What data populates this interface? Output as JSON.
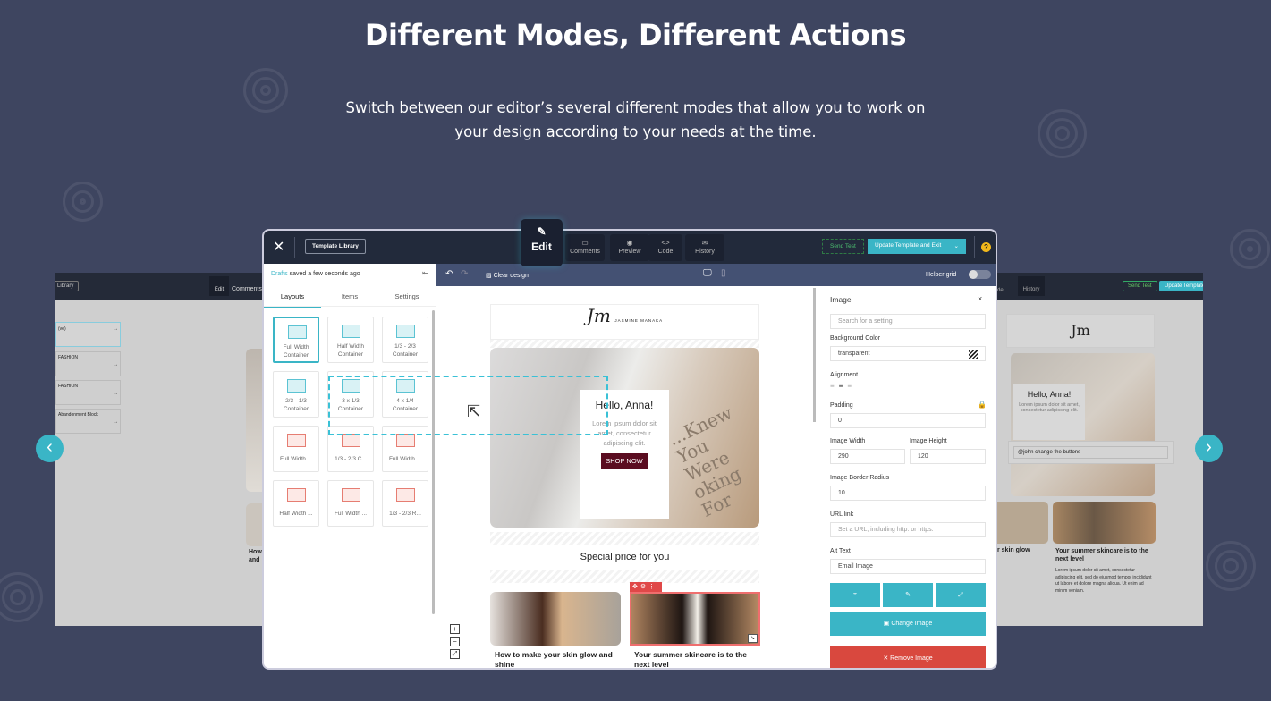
{
  "page": {
    "title": "Different Modes, Different Actions",
    "subtitle_line1": "Switch between our editor’s several different modes that allow you to work on",
    "subtitle_line2": "your design according to your needs at the time."
  },
  "colors": {
    "background": "#3e4560",
    "accent": "#3ab5c6",
    "danger": "#d9483e",
    "send_test": "#3db36a"
  },
  "carousel": {
    "prev_icon": "chevron-left-icon",
    "next_icon": "chevron-right-icon"
  },
  "ghost_left": {
    "library_label": "Library",
    "edit_label": "Edit",
    "comments_label": "Comments",
    "items": [
      {
        "title": "",
        "subtitle": "(ve)"
      },
      {
        "title": "FASHION"
      },
      {
        "title": "FASHION"
      },
      {
        "title": "Abandonment Block"
      }
    ],
    "card_text": [
      "How",
      "and"
    ]
  },
  "ghost_right": {
    "code_label": "de",
    "history_label": "History",
    "send_test": "Send Test",
    "update": "Update Template",
    "hello": "Hello, Anna!",
    "lorem": "Lorem ipsum dolor sit amet, consectetur adipiscing elit.",
    "comment": "@john change the buttons",
    "card_title_left": "r skin glow",
    "card_title_right": "Your summer skincare is to the next level",
    "card_body": "Lorem ipsum dolor sit amet, consectetur adipiscing elit, sed do eiusmod tempor incididunt ut labore et dolore magna aliqua. Ut enim ad minim veniam."
  },
  "editor": {
    "close_icon": "close-icon",
    "template_library": "Template Library",
    "modes": [
      {
        "label": "Edit",
        "icon": "pencil-icon"
      },
      {
        "label": "Comments",
        "icon": "comment-icon"
      },
      {
        "label": "Preview",
        "icon": "eye-icon"
      },
      {
        "label": "Code",
        "icon": "code-icon"
      },
      {
        "label": "History",
        "icon": "history-icon"
      }
    ],
    "send_test": "Send Test",
    "update_exit": "Update Template and Exit",
    "help": "?",
    "drafts": "Drafts",
    "saved": "saved a few seconds ago",
    "clear_design": "Clear design",
    "helper_grid": "Helper grid",
    "helper_grid_on": false,
    "tabs": [
      "Layouts",
      "Items",
      "Settings"
    ],
    "active_tab": "Layouts",
    "layouts": [
      {
        "l1": "Full Width",
        "l2": "Container",
        "type": "container"
      },
      {
        "l1": "Half Width",
        "l2": "Container",
        "type": "container"
      },
      {
        "l1": "1/3 - 2/3",
        "l2": "Container",
        "type": "container"
      },
      {
        "l1": "2/3 - 1/3",
        "l2": "Container",
        "type": "container"
      },
      {
        "l1": "3 x 1/3",
        "l2": "Container",
        "type": "container"
      },
      {
        "l1": "4 x 1/4",
        "l2": "Container",
        "type": "container"
      },
      {
        "l1": "Full Width ...",
        "l2": "",
        "type": "block"
      },
      {
        "l1": "1/3 - 2/3 C...",
        "l2": "",
        "type": "block"
      },
      {
        "l1": "Full Width ...",
        "l2": "",
        "type": "block"
      },
      {
        "l1": "Half Width ...",
        "l2": "",
        "type": "block"
      },
      {
        "l1": "Full Width ...",
        "l2": "",
        "type": "block"
      },
      {
        "l1": "1/3 - 2/3 R...",
        "l2": "",
        "type": "block"
      }
    ],
    "email": {
      "logo": "Jm",
      "brand": "JASMINE MANAKA",
      "hello": "Hello, Anna!",
      "lorem": "Lorem ipsum dolor sit amet, consectetur adipiscing elit.",
      "shop": "SHOP NOW",
      "special": "Special price for you",
      "card1": "How to make your skin glow and shine",
      "card2": "Your summer skincare is to the next level"
    },
    "panel": {
      "title": "Image",
      "search_placeholder": "Search for a setting",
      "bg_label": "Background Color",
      "bg_value": "transparent",
      "align_label": "Alignment",
      "align_value": "center",
      "padding_label": "Padding",
      "padding_value": "0",
      "width_label": "Image Width",
      "width_value": "290",
      "height_label": "Image Height",
      "height_value": "120",
      "radius_label": "Image Border Radius",
      "radius_value": "10",
      "url_label": "URL link",
      "url_placeholder": "Set a URL, including http: or https:",
      "alt_label": "Alt Text",
      "alt_value": "Email Image",
      "change": "Change Image",
      "remove": "Remove Image"
    }
  }
}
